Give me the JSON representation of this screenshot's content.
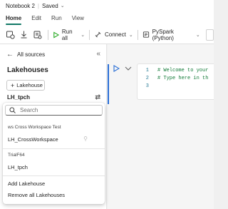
{
  "title_bar": {
    "notebook_name": "Notebook 2",
    "save_status": "Saved"
  },
  "menu": {
    "tabs": [
      "Home",
      "Edit",
      "Run",
      "View"
    ],
    "active_tab": "Home"
  },
  "toolbar": {
    "run_all_label": "Run all",
    "connect_label": "Connect",
    "language_label": "PySpark (Python)"
  },
  "panel": {
    "back_label": "All sources",
    "title": "Lakehouses",
    "add_button_label": "Lakehouse",
    "selected_lakehouse": "LH_tpch"
  },
  "dropdown": {
    "search_placeholder": "Search",
    "groups": [
      {
        "name": "ws Cross Workspace Test",
        "items": [
          "LH_CrossWorkspace"
        ]
      },
      {
        "name": "TrialF64",
        "items": [
          "LH_tpch"
        ]
      }
    ],
    "actions": [
      "Add Lakehouse",
      "Remove all Lakehouses"
    ]
  },
  "editor": {
    "lines": [
      {
        "num": "1",
        "text": "# Welcome to your"
      },
      {
        "num": "2",
        "text": "# Type here in th"
      },
      {
        "num": "3",
        "text": ""
      }
    ]
  },
  "colors": {
    "accent": "#117865",
    "run_green": "#13a10e",
    "cell_active": "#2a6fd6",
    "comment": "#117a37"
  }
}
